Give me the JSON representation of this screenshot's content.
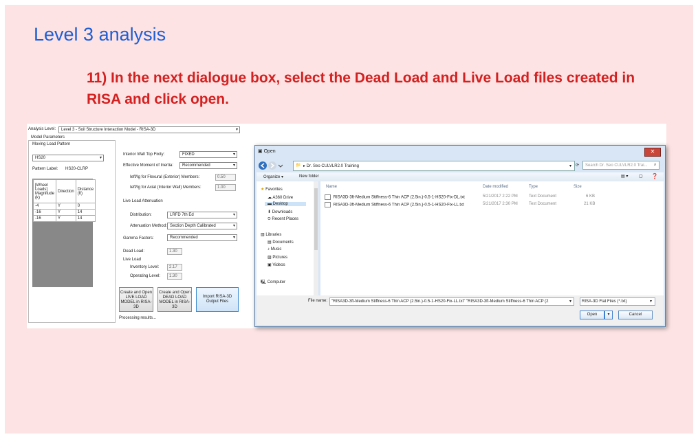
{
  "slide": {
    "title": "Level 3 analysis",
    "instruction": "11) In the next dialogue box, select the Dead Load and Live Load files created in RISA and click open."
  },
  "app": {
    "analysis_level_label": "Analysis Level:",
    "analysis_level_value": "Level 3 - Soil Structure Interaction Model - RISA-3D",
    "model_parameters": "Model Parameters",
    "moving_load_pattern": "Moving Load Pattern",
    "pattern_value": "HS20",
    "pattern_label": "Pattern Label:",
    "pattern_label_value": "HS20-CLRP",
    "table": {
      "headers": [
        "[Wheel Loads] Magnitude (k)",
        "Direction",
        "Distance (ft)"
      ],
      "rows": [
        [
          "-4",
          "Y",
          "0"
        ],
        [
          "-16",
          "Y",
          "14"
        ],
        [
          "-16",
          "Y",
          "14"
        ]
      ]
    },
    "interior_wall_label": "Interior Wall Top Fixity:",
    "interior_wall_value": "FIXED",
    "moment_label": "Effective Moment of Inertia:",
    "moment_value": "Recommended",
    "flexural_label": "Ieff/Ig for Flexural (Exterior) Members:",
    "flexural_value": "0.50",
    "axial_label": "Ieff/Ig for Axial (Interior Wall) Members:",
    "axial_value": "1.00",
    "live_load_attenuation": "Live Load Attenuation",
    "distribution_label": "Distribution:",
    "distribution_value": "LRFD 7th Ed",
    "attenuation_label": "Attenuation Method:",
    "attenuation_value": "Section Depth Calibrated",
    "gamma_label": "Gamma Factors:",
    "gamma_value": "Recommended",
    "dead_load_label": "Dead Load:",
    "dead_load_value": "1.30",
    "live_load_label": "Live Load",
    "inventory_label": "Inventory Level:",
    "inventory_value": "2.17",
    "operating_label": "Operating Level:",
    "operating_value": "1.30",
    "btn_live": "Create and Open LIVE LOAD MODEL in RISA-3D",
    "btn_dead": "Create and Open DEAD LOAD MODEL in RISA-3D",
    "btn_import": "Import RISA-3D Output Files",
    "status": "Processing results..."
  },
  "dialog": {
    "title": "Open",
    "close": "✕",
    "path": "▸ Dr. Seo CULVLR2.0 Training",
    "search_placeholder": "Search Dr. Seo CULVLR2.0 Trai...",
    "organize": "Organize ▾",
    "new_folder": "New folder",
    "nav": {
      "favorites": "Favorites",
      "items": [
        "A360 Drive",
        "Desktop",
        "Downloads",
        "Recent Places"
      ],
      "libraries": "Libraries",
      "lib_items": [
        "Documents",
        "Music",
        "Pictures",
        "Videos"
      ],
      "computer": "Computer"
    },
    "columns": [
      "Name",
      "Date modified",
      "Type",
      "Size"
    ],
    "files": [
      {
        "name": "RISA3D-3ft-Medium Stiffness-6 Thin ACP (2.5in.)-0.5-1-HS20-Fix-DL.txt",
        "date": "5/21/2017 2:22 PM",
        "type": "Text Document",
        "size": "6 KB"
      },
      {
        "name": "RISA3D-3ft-Medium Stiffness-6 Thin ACP (2.5in.)-0.5-1-HS20-Fix-LL.txt",
        "date": "5/21/2017 2:30 PM",
        "type": "Text Document",
        "size": "21 KB"
      }
    ],
    "file_name_label": "File name:",
    "file_name_value": "\"RISA3D-3ft-Medium Stiffness-6 Thin ACP (2.5in.)-0.5-1-HS20-Fix-LL.txt\" \"RISA3D-3ft-Medium Stiffness-6 Thin ACP (2",
    "filter_value": "RISA-3D Flat Files (*.txt)",
    "open_label": "Open",
    "cancel_label": "Cancel"
  }
}
